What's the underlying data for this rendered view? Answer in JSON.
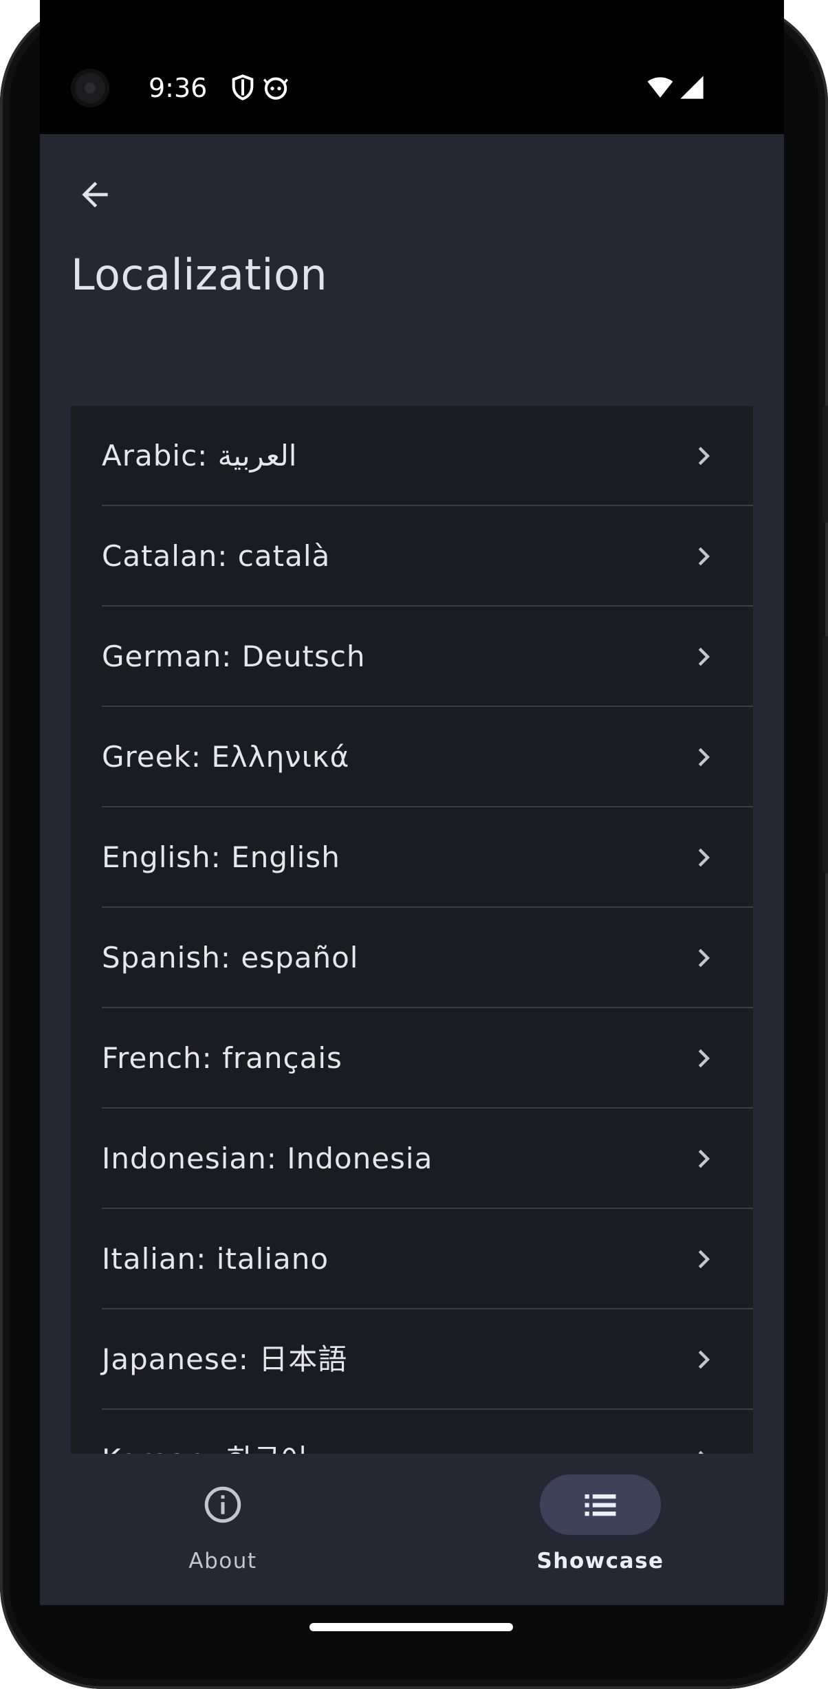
{
  "status_bar": {
    "time": "9:36",
    "icons": [
      "shield-icon",
      "android-icon",
      "wifi-icon",
      "signal-icon"
    ]
  },
  "app_bar": {
    "back_icon": "arrow-left-icon",
    "title": "Localization"
  },
  "languages": [
    {
      "label": "Arabic: العربية"
    },
    {
      "label": "Catalan: català"
    },
    {
      "label": "German: Deutsch"
    },
    {
      "label": "Greek: Ελληνικά"
    },
    {
      "label": "English: English"
    },
    {
      "label": "Spanish: español"
    },
    {
      "label": "French: français"
    },
    {
      "label": "Indonesian: Indonesia"
    },
    {
      "label": "Italian: italiano"
    },
    {
      "label": "Japanese: 日本語"
    },
    {
      "label": "Korean: 한국어"
    }
  ],
  "bottom_nav": {
    "items": [
      {
        "label": "About",
        "icon": "info-icon",
        "selected": false
      },
      {
        "label": "Showcase",
        "icon": "list-icon",
        "selected": true
      }
    ]
  },
  "colors": {
    "background": "#252833",
    "list_background": "#1b1c21",
    "text": "#e6e6ec",
    "active_pill": "#3d4258"
  }
}
